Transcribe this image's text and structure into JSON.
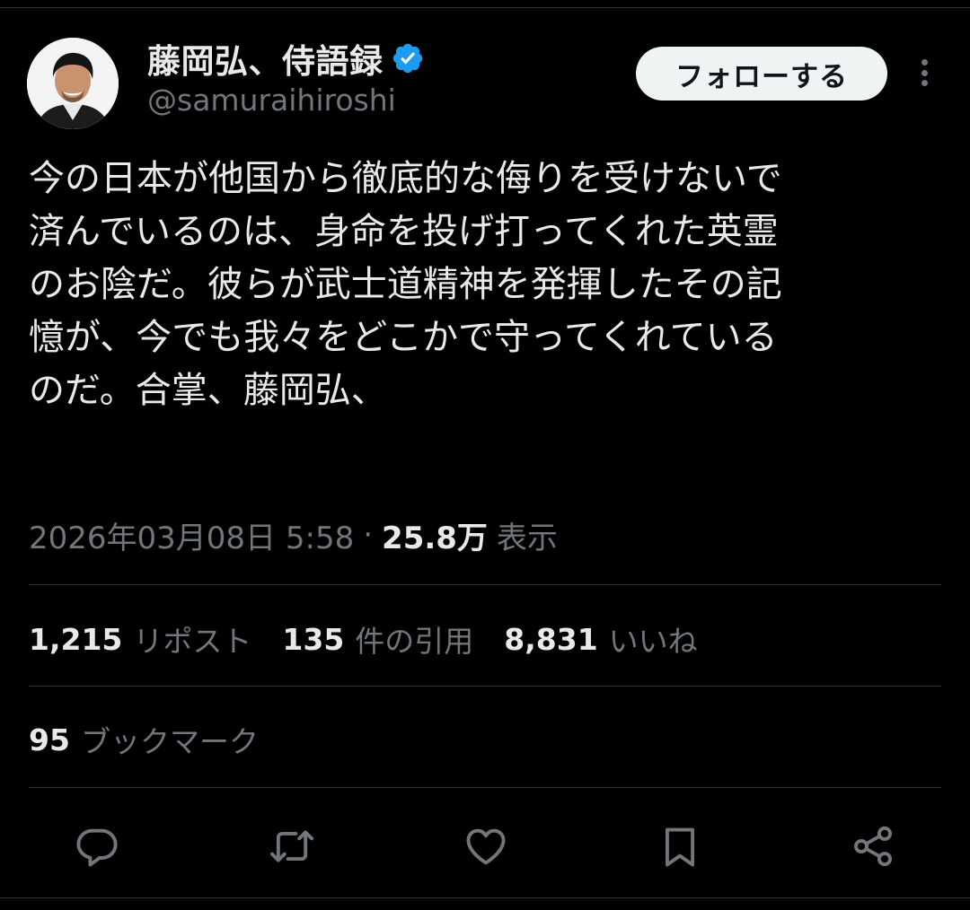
{
  "author": {
    "display_name": "藤岡弘、侍語録",
    "handle": "@samuraihiroshi",
    "verified_icon": "verified-badge-icon",
    "verified_color": "#1d9bf0",
    "avatar": "avatar-photo"
  },
  "follow_button": {
    "label": "フォローする"
  },
  "more_menu": {
    "icon": "more-vertical-icon"
  },
  "tweet": {
    "lines": [
      "今の日本が他国から徹底的な侮りを受けないで",
      "済んでいるのは、身命を投げ打ってくれた英霊",
      "のお陰だ。彼らが武士道精神を発揮したその記",
      "憶が、今でも我々をどこかで守ってくれている",
      "のだ。合掌、藤岡弘、"
    ]
  },
  "meta": {
    "timestamp": "2026年03月08日 5:58",
    "separator": "·",
    "views_count": "25.8万",
    "views_label": "表示"
  },
  "stats": {
    "reposts": {
      "count": "1,215",
      "label": "リポスト"
    },
    "quotes": {
      "count": "135",
      "label": "件の引用"
    },
    "likes": {
      "count": "8,831",
      "label": "いいね"
    },
    "bookmarks": {
      "count": "95",
      "label": "ブックマーク"
    }
  },
  "actions": [
    {
      "name": "reply",
      "icon": "reply-icon"
    },
    {
      "name": "repost",
      "icon": "repost-icon"
    },
    {
      "name": "like",
      "icon": "heart-icon"
    },
    {
      "name": "bookmark",
      "icon": "bookmark-icon"
    },
    {
      "name": "share",
      "icon": "share-icon"
    }
  ],
  "colors": {
    "background": "#000000",
    "text_primary": "#e7e9ea",
    "text_secondary": "#71767b",
    "divider": "#2f3336",
    "button_bg": "#eff3f4",
    "button_text": "#0f1419"
  }
}
